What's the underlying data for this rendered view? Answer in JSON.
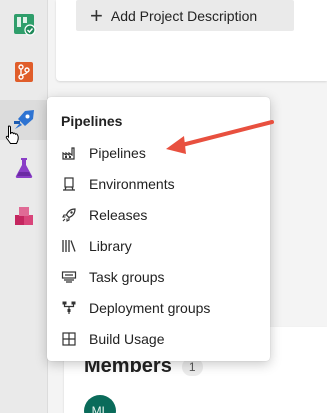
{
  "rail": {
    "items": [
      {
        "name": "boards",
        "icon": "boards-icon",
        "color": "#2f9e6b"
      },
      {
        "name": "repos",
        "icon": "repos-icon",
        "color": "#e05d2a"
      },
      {
        "name": "pipelines",
        "icon": "pipelines-icon",
        "color": "#2d73d2",
        "active": true
      },
      {
        "name": "test-plans",
        "icon": "test-plans-icon",
        "color": "#8a3ec7"
      },
      {
        "name": "artifacts",
        "icon": "artifacts-icon",
        "color": "#c4265f"
      }
    ]
  },
  "project": {
    "add_description_label": "Add Project Description"
  },
  "members": {
    "title": "Members",
    "count": "1",
    "avatar_initials": "ML"
  },
  "flyout": {
    "title": "Pipelines",
    "items": [
      {
        "label": "Pipelines",
        "icon": "pipelines-factory-icon"
      },
      {
        "label": "Environments",
        "icon": "environments-icon"
      },
      {
        "label": "Releases",
        "icon": "rocket-icon"
      },
      {
        "label": "Library",
        "icon": "library-icon"
      },
      {
        "label": "Task groups",
        "icon": "task-groups-icon"
      },
      {
        "label": "Deployment groups",
        "icon": "deployment-groups-icon"
      },
      {
        "label": "Build Usage",
        "icon": "grid-icon"
      }
    ]
  },
  "annotation": {
    "arrow_color": "#e8503f"
  }
}
